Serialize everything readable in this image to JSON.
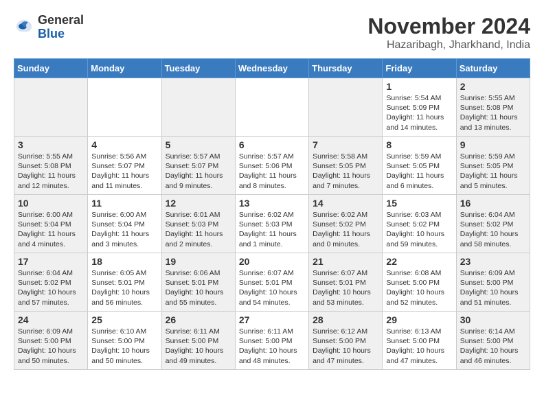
{
  "header": {
    "logo": {
      "general": "General",
      "blue": "Blue"
    },
    "title": "November 2024",
    "location": "Hazaribagh, Jharkhand, India"
  },
  "weekdays": [
    "Sunday",
    "Monday",
    "Tuesday",
    "Wednesday",
    "Thursday",
    "Friday",
    "Saturday"
  ],
  "weeks": [
    [
      {
        "day": "",
        "info": ""
      },
      {
        "day": "",
        "info": ""
      },
      {
        "day": "",
        "info": ""
      },
      {
        "day": "",
        "info": ""
      },
      {
        "day": "",
        "info": ""
      },
      {
        "day": "1",
        "info": "Sunrise: 5:54 AM\nSunset: 5:09 PM\nDaylight: 11 hours and 14 minutes."
      },
      {
        "day": "2",
        "info": "Sunrise: 5:55 AM\nSunset: 5:08 PM\nDaylight: 11 hours and 13 minutes."
      }
    ],
    [
      {
        "day": "3",
        "info": "Sunrise: 5:55 AM\nSunset: 5:08 PM\nDaylight: 11 hours and 12 minutes."
      },
      {
        "day": "4",
        "info": "Sunrise: 5:56 AM\nSunset: 5:07 PM\nDaylight: 11 hours and 11 minutes."
      },
      {
        "day": "5",
        "info": "Sunrise: 5:57 AM\nSunset: 5:07 PM\nDaylight: 11 hours and 9 minutes."
      },
      {
        "day": "6",
        "info": "Sunrise: 5:57 AM\nSunset: 5:06 PM\nDaylight: 11 hours and 8 minutes."
      },
      {
        "day": "7",
        "info": "Sunrise: 5:58 AM\nSunset: 5:05 PM\nDaylight: 11 hours and 7 minutes."
      },
      {
        "day": "8",
        "info": "Sunrise: 5:59 AM\nSunset: 5:05 PM\nDaylight: 11 hours and 6 minutes."
      },
      {
        "day": "9",
        "info": "Sunrise: 5:59 AM\nSunset: 5:05 PM\nDaylight: 11 hours and 5 minutes."
      }
    ],
    [
      {
        "day": "10",
        "info": "Sunrise: 6:00 AM\nSunset: 5:04 PM\nDaylight: 11 hours and 4 minutes."
      },
      {
        "day": "11",
        "info": "Sunrise: 6:00 AM\nSunset: 5:04 PM\nDaylight: 11 hours and 3 minutes."
      },
      {
        "day": "12",
        "info": "Sunrise: 6:01 AM\nSunset: 5:03 PM\nDaylight: 11 hours and 2 minutes."
      },
      {
        "day": "13",
        "info": "Sunrise: 6:02 AM\nSunset: 5:03 PM\nDaylight: 11 hours and 1 minute."
      },
      {
        "day": "14",
        "info": "Sunrise: 6:02 AM\nSunset: 5:02 PM\nDaylight: 11 hours and 0 minutes."
      },
      {
        "day": "15",
        "info": "Sunrise: 6:03 AM\nSunset: 5:02 PM\nDaylight: 10 hours and 59 minutes."
      },
      {
        "day": "16",
        "info": "Sunrise: 6:04 AM\nSunset: 5:02 PM\nDaylight: 10 hours and 58 minutes."
      }
    ],
    [
      {
        "day": "17",
        "info": "Sunrise: 6:04 AM\nSunset: 5:02 PM\nDaylight: 10 hours and 57 minutes."
      },
      {
        "day": "18",
        "info": "Sunrise: 6:05 AM\nSunset: 5:01 PM\nDaylight: 10 hours and 56 minutes."
      },
      {
        "day": "19",
        "info": "Sunrise: 6:06 AM\nSunset: 5:01 PM\nDaylight: 10 hours and 55 minutes."
      },
      {
        "day": "20",
        "info": "Sunrise: 6:07 AM\nSunset: 5:01 PM\nDaylight: 10 hours and 54 minutes."
      },
      {
        "day": "21",
        "info": "Sunrise: 6:07 AM\nSunset: 5:01 PM\nDaylight: 10 hours and 53 minutes."
      },
      {
        "day": "22",
        "info": "Sunrise: 6:08 AM\nSunset: 5:00 PM\nDaylight: 10 hours and 52 minutes."
      },
      {
        "day": "23",
        "info": "Sunrise: 6:09 AM\nSunset: 5:00 PM\nDaylight: 10 hours and 51 minutes."
      }
    ],
    [
      {
        "day": "24",
        "info": "Sunrise: 6:09 AM\nSunset: 5:00 PM\nDaylight: 10 hours and 50 minutes."
      },
      {
        "day": "25",
        "info": "Sunrise: 6:10 AM\nSunset: 5:00 PM\nDaylight: 10 hours and 50 minutes."
      },
      {
        "day": "26",
        "info": "Sunrise: 6:11 AM\nSunset: 5:00 PM\nDaylight: 10 hours and 49 minutes."
      },
      {
        "day": "27",
        "info": "Sunrise: 6:11 AM\nSunset: 5:00 PM\nDaylight: 10 hours and 48 minutes."
      },
      {
        "day": "28",
        "info": "Sunrise: 6:12 AM\nSunset: 5:00 PM\nDaylight: 10 hours and 47 minutes."
      },
      {
        "day": "29",
        "info": "Sunrise: 6:13 AM\nSunset: 5:00 PM\nDaylight: 10 hours and 47 minutes."
      },
      {
        "day": "30",
        "info": "Sunrise: 6:14 AM\nSunset: 5:00 PM\nDaylight: 10 hours and 46 minutes."
      }
    ]
  ]
}
